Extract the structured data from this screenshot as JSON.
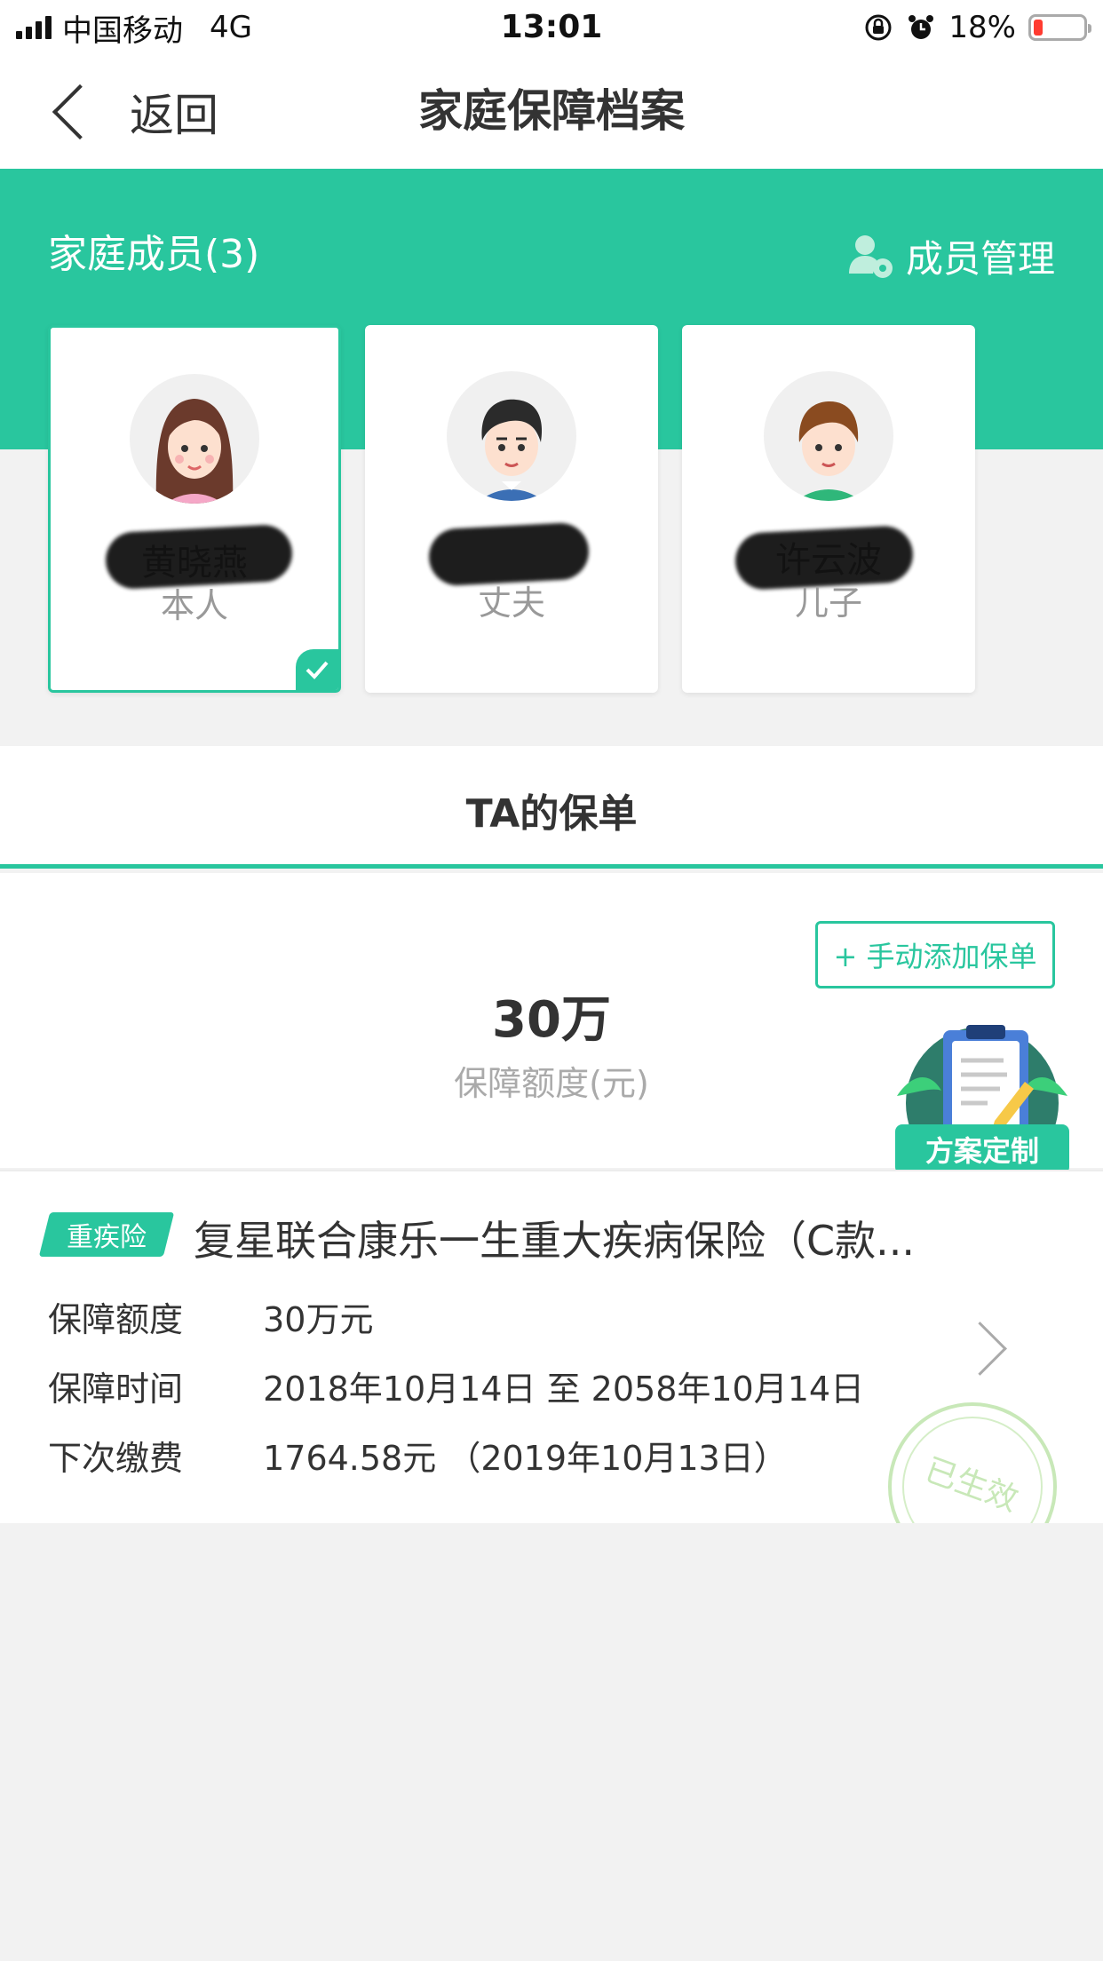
{
  "status_bar": {
    "carrier": "中国移动",
    "network": "4G",
    "time": "13:01",
    "battery_percent": "18%",
    "battery_level": 0.18,
    "battery_color": "#ff3b30",
    "icons": [
      "signal-icon",
      "orientation-lock-icon",
      "alarm-icon",
      "battery-icon"
    ]
  },
  "nav": {
    "back_label": "返回",
    "title": "家庭保障档案"
  },
  "family": {
    "title": "家庭成员(3)",
    "manage_label": "成员管理",
    "members": [
      {
        "name": "黄晓燕",
        "role": "本人",
        "selected": true
      },
      {
        "name": "",
        "role": "丈夫",
        "selected": false
      },
      {
        "name": "许云波",
        "role": "儿子",
        "selected": false
      }
    ]
  },
  "policies_section": {
    "title": "TA的保单",
    "add_button": "+ 手动添加保单",
    "total_amount": "30万",
    "total_label": "保障额度(元)",
    "plan_badge_label": "方案定制"
  },
  "policy": {
    "tag": "重疾险",
    "name": "复星联合康乐一生重大疾病保险（C款...",
    "rows": [
      {
        "label": "保障额度",
        "value": "30万元"
      },
      {
        "label": "保障时间",
        "value": "2018年10月14日 至 2058年10月14日"
      },
      {
        "label": "下次缴费",
        "value": "1764.58元 （2019年10月13日）"
      }
    ],
    "stamp": "已生效"
  },
  "colors": {
    "accent": "#29c69e",
    "background": "#f2f2f2"
  }
}
